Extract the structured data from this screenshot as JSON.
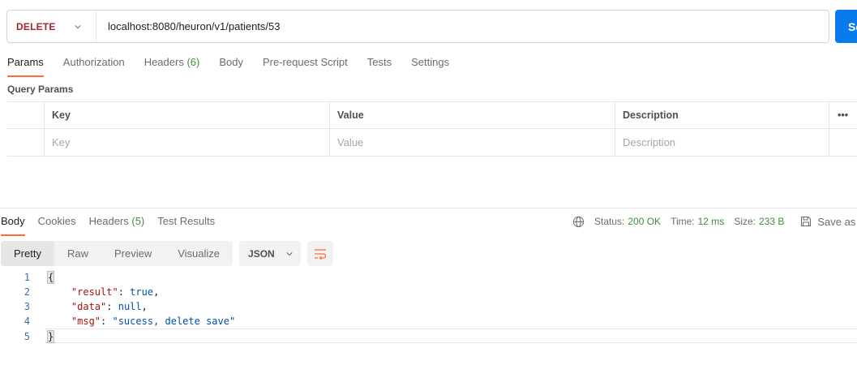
{
  "request": {
    "method": "DELETE",
    "url": "localhost:8080/heuron/v1/patients/53",
    "send_label": "Send"
  },
  "request_tabs": [
    {
      "label": "Params",
      "count": ""
    },
    {
      "label": "Authorization",
      "count": ""
    },
    {
      "label": "Headers",
      "count": "(6)"
    },
    {
      "label": "Body",
      "count": ""
    },
    {
      "label": "Pre-request Script",
      "count": ""
    },
    {
      "label": "Tests",
      "count": ""
    },
    {
      "label": "Settings",
      "count": ""
    }
  ],
  "query_params": {
    "title": "Query Params",
    "headers": {
      "key": "Key",
      "value": "Value",
      "description": "Description",
      "more": "•••"
    },
    "placeholders": {
      "key": "Key",
      "value": "Value",
      "description": "Description"
    }
  },
  "response_tabs": [
    {
      "label": "Body",
      "count": ""
    },
    {
      "label": "Cookies",
      "count": ""
    },
    {
      "label": "Headers",
      "count": "(5)"
    },
    {
      "label": "Test Results",
      "count": ""
    }
  ],
  "response_status": {
    "status_label": "Status:",
    "status_value": "200 OK",
    "time_label": "Time:",
    "time_value": "12 ms",
    "size_label": "Size:",
    "size_value": "233 B",
    "save_label": "Save as E"
  },
  "format_tabs": [
    "Pretty",
    "Raw",
    "Preview",
    "Visualize"
  ],
  "format_select": "JSON",
  "code_lines": [
    {
      "n": "1",
      "text": "{"
    },
    {
      "n": "2",
      "key": "\"result\"",
      "val": "true",
      "tail": ","
    },
    {
      "n": "3",
      "key": "\"data\"",
      "val": "null",
      "tail": ","
    },
    {
      "n": "4",
      "key": "\"msg\"",
      "val": "\"sucess, delete save\"",
      "tail": ""
    },
    {
      "n": "5",
      "text": "}"
    }
  ],
  "colors": {
    "accent": "#ff6c37",
    "send": "#097bed",
    "method": "#a4262c",
    "status_ok": "#3b8f3b"
  }
}
